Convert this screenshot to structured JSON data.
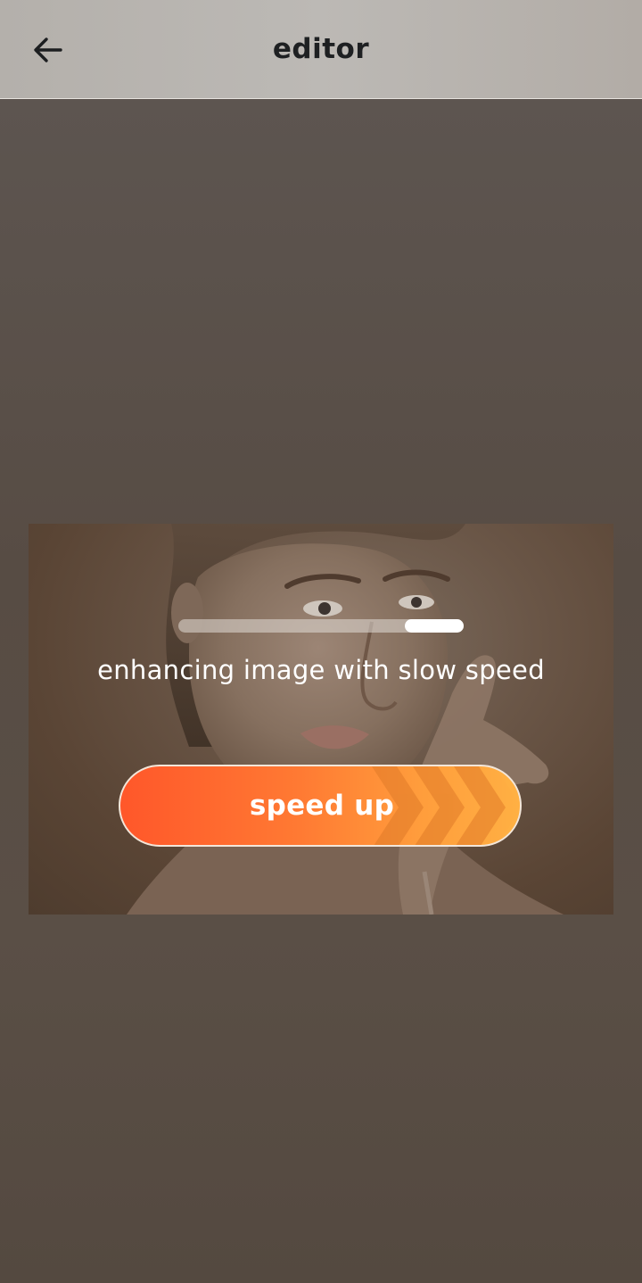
{
  "header": {
    "title": "editor",
    "back_icon": "arrow-left-icon"
  },
  "processing": {
    "status_text": "enhancing image with slow speed",
    "progress": 0.2
  },
  "speed_button": {
    "label": "speed up",
    "icon": "chevrons-right-icon"
  },
  "colors": {
    "accent_start": "#ff572a",
    "accent_end": "#ffb043",
    "overlay": "#5b5048"
  }
}
